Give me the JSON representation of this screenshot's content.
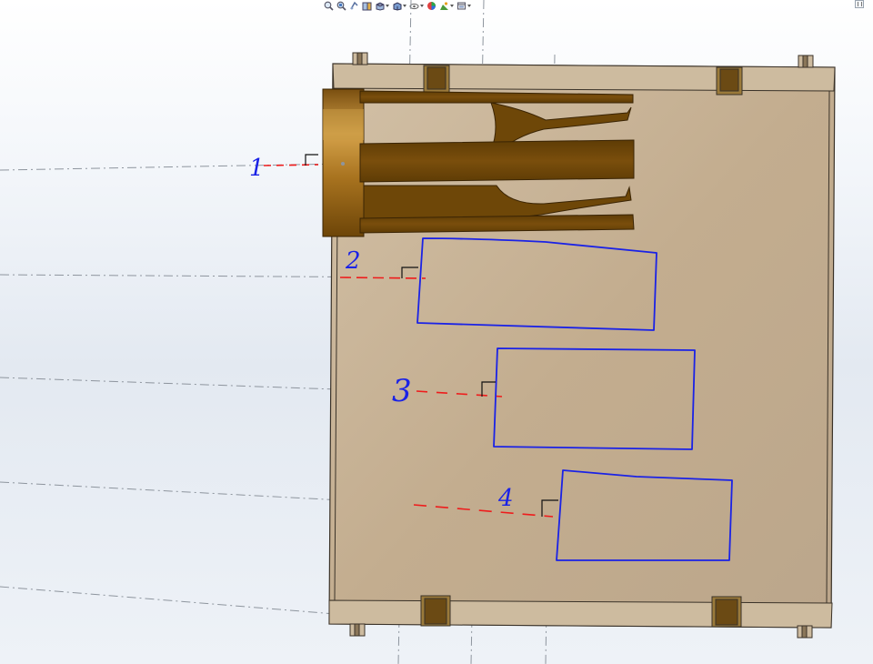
{
  "colors": {
    "plate": "#c8b498",
    "plate_edge": "#3a3228",
    "part": "#6e4708",
    "part_highlight": "#9b6a1a",
    "sketch": "#1a22e6",
    "dim": "#ee1c1c"
  },
  "toolbar": {
    "buttons": [
      {
        "name": "zoom-to-fit-icon",
        "dropdown": false
      },
      {
        "name": "zoom-to-area-icon",
        "dropdown": false
      },
      {
        "name": "previous-view-icon",
        "dropdown": false
      },
      {
        "name": "section-view-icon",
        "dropdown": false
      },
      {
        "name": "view-orientation-icon",
        "dropdown": true
      },
      {
        "name": "display-style-icon",
        "dropdown": true
      },
      {
        "name": "hide-show-items-icon",
        "dropdown": true
      },
      {
        "name": "edit-appearance-icon",
        "dropdown": false
      },
      {
        "name": "apply-scene-icon",
        "dropdown": true
      },
      {
        "name": "view-settings-icon",
        "dropdown": true
      }
    ]
  },
  "annotations": [
    {
      "id": "1",
      "label": "1"
    },
    {
      "id": "2",
      "label": "2"
    },
    {
      "id": "3",
      "label": "3"
    },
    {
      "id": "4",
      "label": "4"
    }
  ]
}
